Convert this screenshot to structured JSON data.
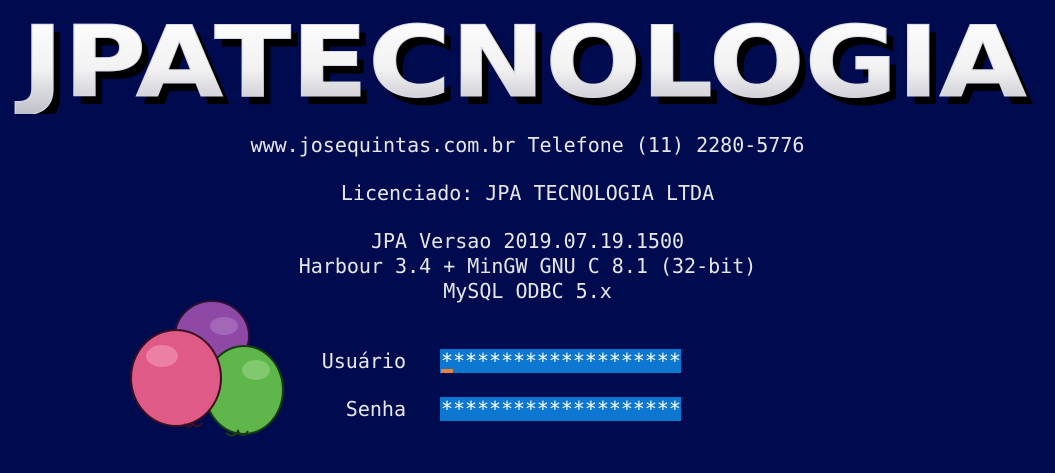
{
  "app": {
    "logo_text": "JPATECNOLOGIA"
  },
  "info": {
    "website": "www.josequintas.com.br Telefone (11) 2280-5776",
    "license": "Licenciado: JPA TECNOLOGIA LTDA",
    "version": "JPA Versao 2019.07.19.1500",
    "compiler": "Harbour 3.4 + MinGW GNU C 8.1 (32-bit)",
    "database": "MySQL ODBC 5.x"
  },
  "login": {
    "user_label": "Usuário",
    "user_value": "********************",
    "pass_label": "Senha",
    "pass_value": "********************"
  },
  "colors": {
    "background": "#000b4f",
    "field": "#0c77d0",
    "caret": "#e8843a",
    "text": "#e6e6e6",
    "logo_fill": "#ffffff",
    "logo_shadow": "#000000"
  },
  "icons": [
    "balloons-icon"
  ]
}
